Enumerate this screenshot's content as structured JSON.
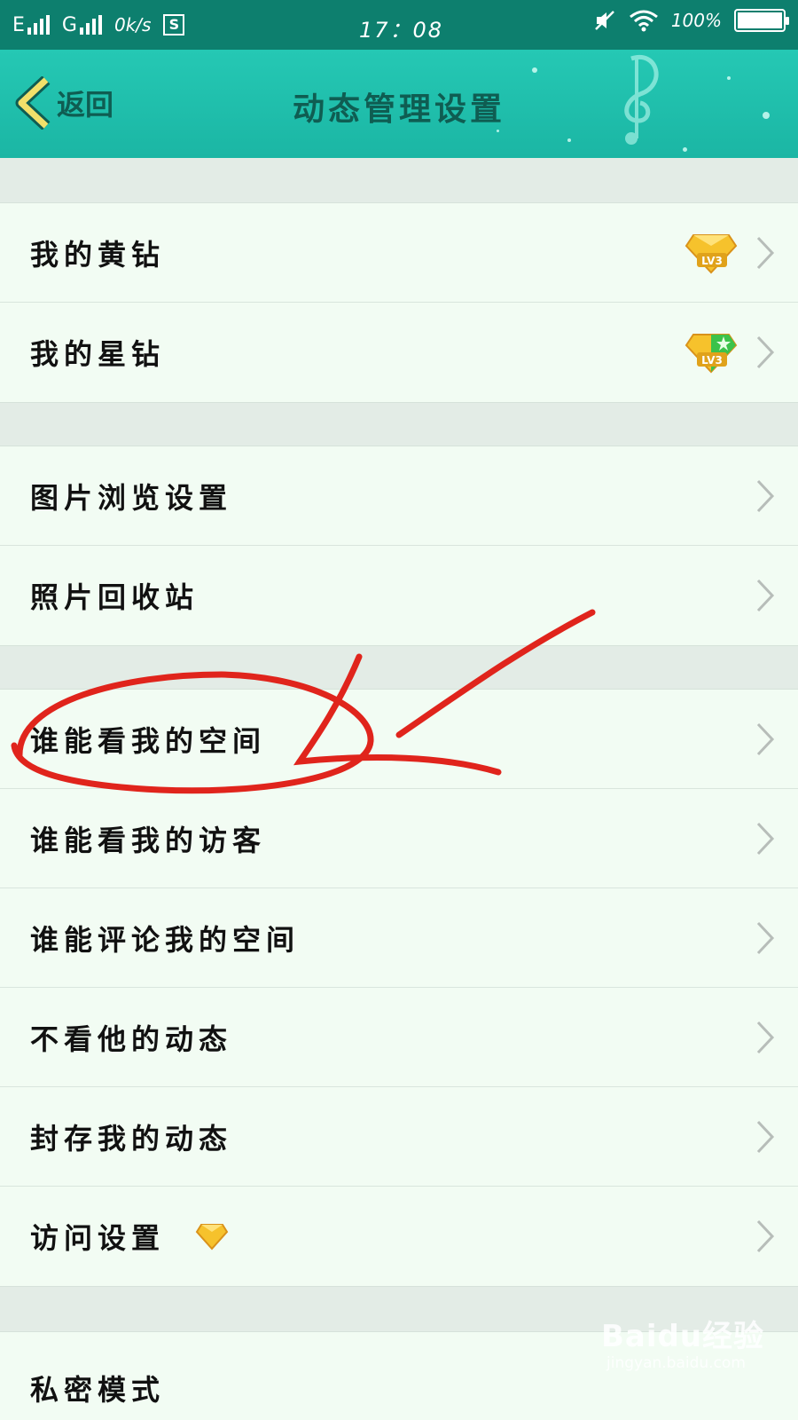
{
  "status_bar": {
    "signal1": "E",
    "signal2": "G",
    "speed": "0k/s",
    "screenshot_icon": "S",
    "time": "17：08",
    "battery": "100%",
    "icons": [
      "signal-icon",
      "signal-icon",
      "screenshot-icon",
      "mute-icon",
      "wifi-icon",
      "battery-icon"
    ]
  },
  "header": {
    "back_label": "返回",
    "title": "动态管理设置",
    "decor_icon": "music-note-icon",
    "color": "#1bb6a4"
  },
  "groups": [
    {
      "items": [
        {
          "label": "我的黄钻",
          "badge": "yellow-diamond-lv3-icon",
          "badge_text": "LV3"
        },
        {
          "label": "我的星钻",
          "badge": "star-diamond-lv3-icon",
          "badge_text": "LV3"
        }
      ]
    },
    {
      "items": [
        {
          "label": "图片浏览设置"
        },
        {
          "label": "照片回收站"
        }
      ]
    },
    {
      "items": [
        {
          "label": "谁能看我的空间",
          "annotated": true
        },
        {
          "label": "谁能看我的访客"
        },
        {
          "label": "谁能评论我的空间"
        },
        {
          "label": "不看他的动态"
        },
        {
          "label": "封存我的动态"
        },
        {
          "label": "访问设置",
          "inline_icon": "yellow-diamond-icon"
        }
      ]
    },
    {
      "items": [
        {
          "label": "私密模式"
        }
      ]
    }
  ],
  "annotation": {
    "color": "#e0241c",
    "shapes": [
      "circle",
      "arrow"
    ]
  },
  "watermark": {
    "brand": "Baidu经验",
    "sub": "jingyan.baidu.com"
  }
}
